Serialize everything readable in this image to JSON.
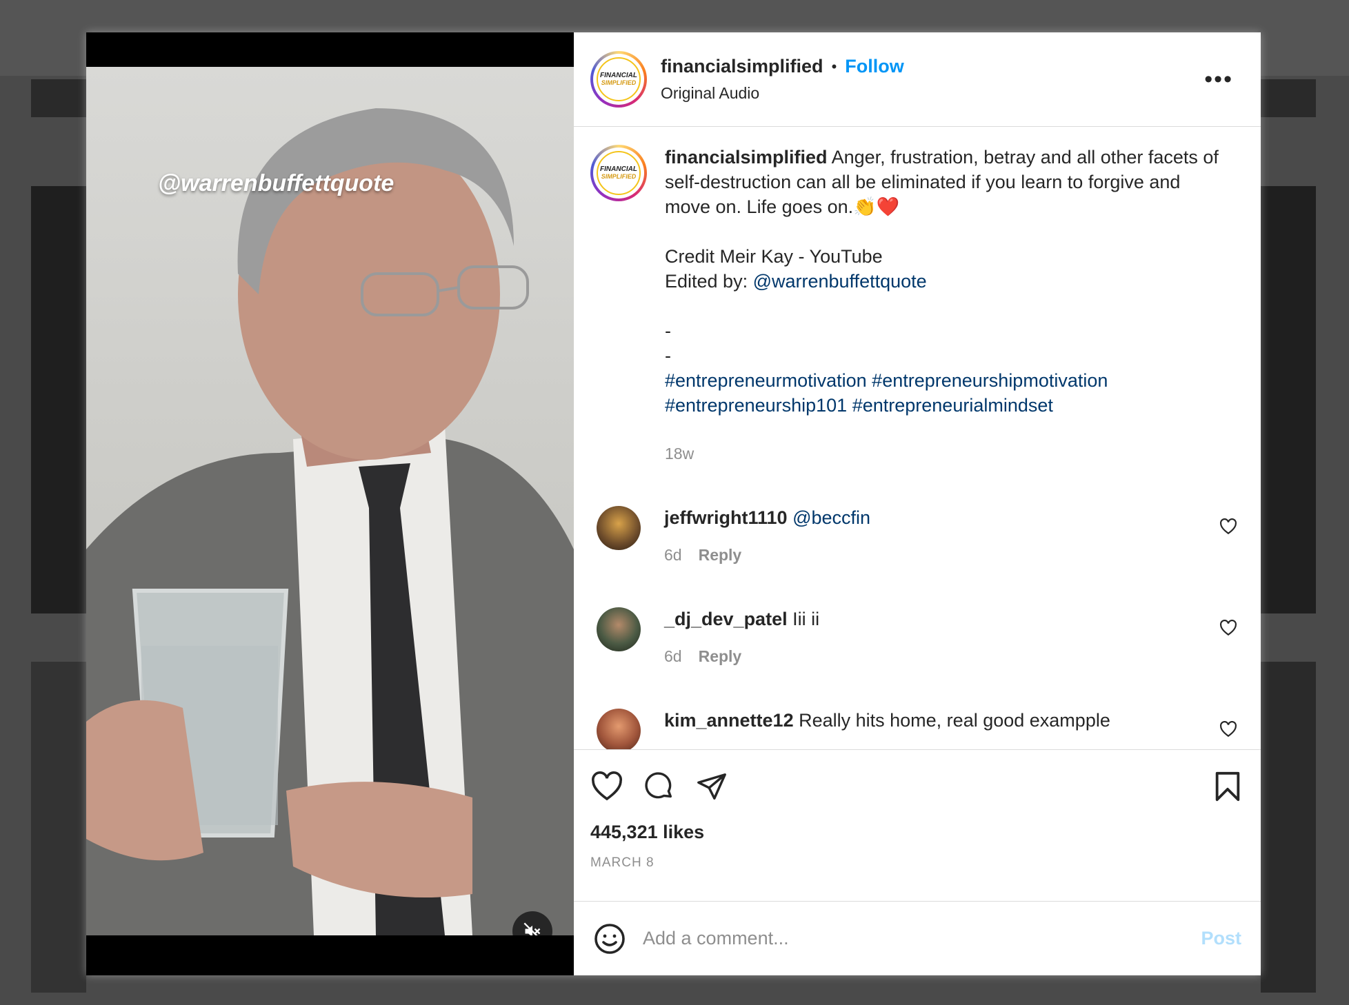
{
  "post": {
    "username": "financialsimplified",
    "separator": "•",
    "follow_label": "Follow",
    "audio": "Original Audio",
    "more_label": "•••",
    "avatar_text_top": "FINANCIAL",
    "avatar_text_bottom": "SIMPLIFIED",
    "video_watermark": "@warrenbuffettquote"
  },
  "caption": {
    "username": "financialsimplified",
    "text": " Anger, frustration, betray and all other facets of self-destruction can all be eliminated if you learn to forgive and move on. Life goes on.👏❤️",
    "credit": "Credit Meir Kay - YouTube",
    "edited_prefix": "Edited by: ",
    "edited_handle": "@warrenbuffettquote",
    "dash1": "-",
    "dash2": "-",
    "hashtags_line1": "#entrepreneurmotivation #entrepreneurshipmotivation",
    "hashtags_line2": "#entrepreneurship101 #entrepreneurialmindset",
    "time": "18w"
  },
  "comments": [
    {
      "username": "jeffwright1110",
      "text": "@beccfin",
      "mention": true,
      "time": "6d",
      "reply": "Reply",
      "avatar_color": "#6b4a2a"
    },
    {
      "username": "_dj_dev_patel",
      "text": " Iii ii",
      "mention": false,
      "time": "6d",
      "reply": "Reply",
      "avatar_color": "#4b5a44"
    },
    {
      "username": "kim_annette12",
      "text": " Really hits home, real good exampple",
      "mention": false,
      "avatar_color": "#a0553b"
    }
  ],
  "actions": {
    "likes": "445,321 likes",
    "date": "MARCH 8"
  },
  "comment_box": {
    "placeholder": "Add a comment...",
    "post_label": "Post"
  },
  "colors": {
    "accent": "#0095f6",
    "link": "#00376b",
    "post_disabled": "#b2dffc"
  }
}
